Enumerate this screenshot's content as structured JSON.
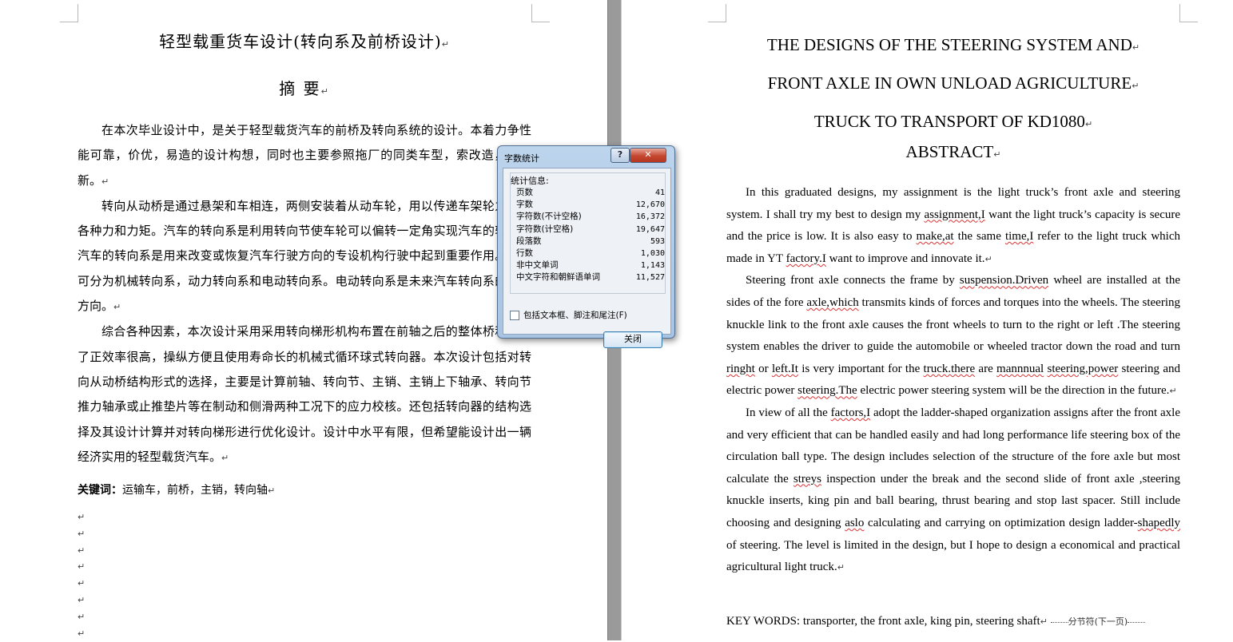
{
  "left_page": {
    "title": "轻型载重货车设计(转向系及前桥设计)",
    "subtitle": "摘 要",
    "paragraph_mark": "↵",
    "paragraphs": [
      "在本次毕业设计中，是关于轻型载货汽车的前桥及转向系统的设计。本着力争性能可靠，价优，易造的设计构想，同时也主要参照拖厂的同类车型，索改造，去创新。",
      "转向从动桥是通过悬架和车相连，两侧安装着从动车轮，用以传递车架轮之间的各种力和力矩。汽车的转向系是利用转向节使车轮可以偏转一定角实现汽车的转向。汽车的转向系是用来改变或恢复汽车行驶方向的专设机构行驶中起到重要作用。主要可分为机械转向系，动力转向系和电动转向系。电动转向系是未来汽车转向系的发展方向。",
      "综合各种因素，本次设计采用采用转向梯形机构布置在前轴之后的整体桥和采用了正效率很高，操纵方便且使用寿命长的机械式循环球式转向器。本次设计包括对转向从动桥结构形式的选择，主要是计算前轴、转向节、主销、主销上下轴承、转向节推力轴承或止推垫片等在制动和侧滑两种工况下的应力校核。还包括转向器的结构选择及其设计计算并对转向梯形进行优化设计。设计中水平有限，但希望能设计出一辆经济实用的轻型载货汽车。"
    ],
    "keywords_label": "关键词：",
    "keywords": "运输车，前桥，主销，转向轴"
  },
  "right_page": {
    "title_lines": [
      "THE DESIGNS OF THE STEERING SYSTEM AND",
      "FRONT AXLE IN OWN UNLOAD AGRICULTURE",
      "TRUCK TO TRANSPORT OF KD1080"
    ],
    "abstract_heading": "ABSTRACT",
    "paragraph_mark": "↵",
    "p1": {
      "a": "In this graduated designs, my assignment is the light truck’s front axle and steering system. I shall try my best to design my ",
      "s1": "assignment,I",
      "b": " want the light truck’s capacity is secure and the price is low. It is also easy to ",
      "s2": "make,at",
      "c": " the same ",
      "s3": "time,I",
      "d": " refer to the light truck which made in YT ",
      "s4": "factory.I",
      "e": " want to improve and innovate it."
    },
    "p2": {
      "a": "Steering front axle connects the frame by ",
      "s1": "suspension.Driven",
      "b": " wheel are installed at the sides of the fore ",
      "s2": "axle,which",
      "c": " transmits kinds of forces and torques into the wheels. The steering knuckle link to the front axle causes the front wheels to turn to the right or left .The steering system enables the driver to guide the automobile or wheeled tractor down the road and turn ",
      "s3": "ringht",
      "d": " or ",
      "s4": "left.It",
      "e": " is very important for the ",
      "s5": "truck.there",
      "f": " are ",
      "s6": "mannnual",
      "g": " ",
      "s7": "steering,power",
      "h": " steering and electric power ",
      "s8": "steering.The",
      "i": " electric power steering system will be the direction in the future."
    },
    "p3": {
      "a": "In view of all the ",
      "s1": "factors,I",
      "b": " adopt the ladder-shaped organization assigns after the front axle and very efficient that can be handled easily and had long performance life steering box of the circulation ball type. The design includes selection of the structure of the fore axle but most calculate the ",
      "s2": "streys",
      "c": " inspection under the break and the second slide of front axle ,steering knuckle inserts, king pin and ball bearing, thrust bearing and stop last spacer. Still include choosing and designing ",
      "s3": "aslo",
      "d": " calculating and carrying on optimization design ladder-",
      "s4": "shapedly",
      "e": " of steering. The level is limited in the design, but I hope to design a economical and practical agricultural light truck."
    },
    "keywords": "KEY WORDS: transporter, the front axle, king pin, steering shaft",
    "section_break": "分节符(下一页)"
  },
  "dialog": {
    "title": "字数统计",
    "help_label": "?",
    "close_x": "✕",
    "stats_heading": "统计信息:",
    "stats": [
      {
        "label": "页数",
        "value": "41"
      },
      {
        "label": "字数",
        "value": "12,670"
      },
      {
        "label": "字符数(不计空格)",
        "value": "16,372"
      },
      {
        "label": "字符数(计空格)",
        "value": "19,647"
      },
      {
        "label": "段落数",
        "value": "593"
      },
      {
        "label": "行数",
        "value": "1,030"
      },
      {
        "label": "非中文单词",
        "value": "1,143"
      },
      {
        "label": "中文字符和朝鲜语单词",
        "value": "11,527"
      }
    ],
    "checkbox_label": "包括文本框、脚注和尾注(F)",
    "checkbox_checked": false,
    "close_button": "关闭"
  }
}
